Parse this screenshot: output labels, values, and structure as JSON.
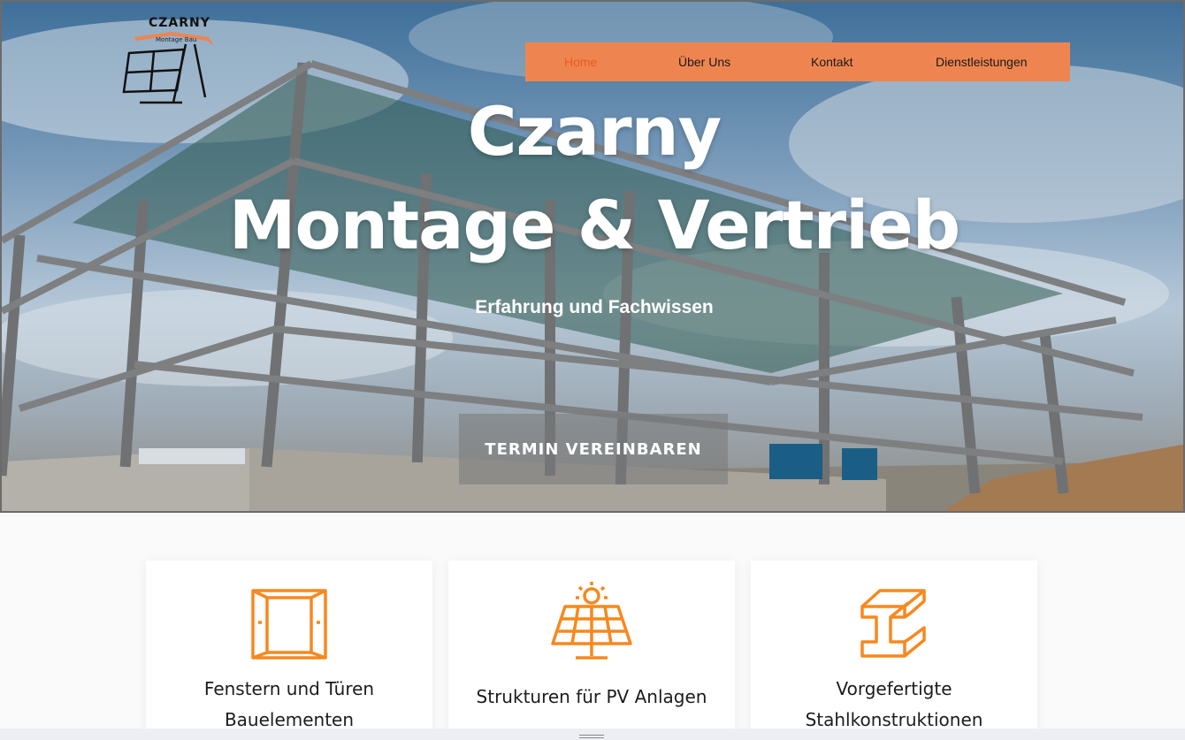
{
  "logo": {
    "brand": "CZARNY",
    "tagline": "Montage Bau"
  },
  "nav": {
    "items": [
      {
        "label": "Home",
        "active": true
      },
      {
        "label": "Über Uns",
        "active": false
      },
      {
        "label": "Kontakt",
        "active": false
      },
      {
        "label": "Dienstleistungen",
        "active": false
      }
    ]
  },
  "hero": {
    "title_line1": "Czarny",
    "title_line2": "Montage & Vertrieb",
    "subtitle": "Erfahrung und Fachwissen",
    "cta_label": "TERMIN VEREINBAREN"
  },
  "services": [
    {
      "icon": "window-door-icon",
      "title_line1": "Fenstern und Türen",
      "title_line2": "Bauelementen"
    },
    {
      "icon": "solar-panel-icon",
      "title_line1": "Strukturen für PV Anlagen",
      "title_line2": ""
    },
    {
      "icon": "steel-beam-icon",
      "title_line1": "Vorgefertigte",
      "title_line2": "Stahlkonstruktionen"
    }
  ],
  "colors": {
    "accent": "#ee8550",
    "icon": "#f7881f",
    "active_nav": "#e85a20"
  }
}
